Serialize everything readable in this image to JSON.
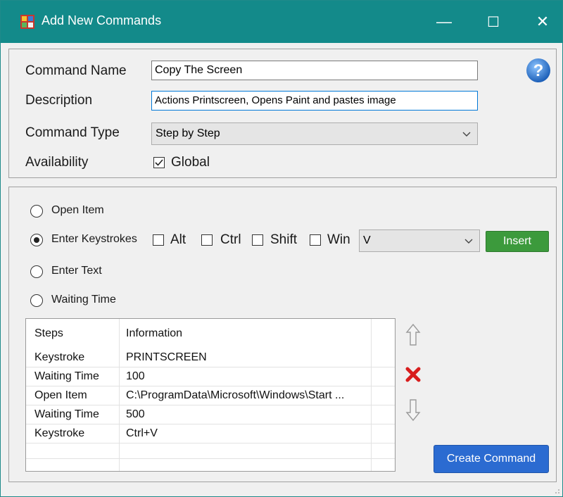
{
  "window": {
    "title": "Add New Commands",
    "minimize_glyph": "—",
    "maximize_glyph": "☐",
    "close_glyph": "✕"
  },
  "form": {
    "command_name_label": "Command Name",
    "command_name_value": "Copy The Screen",
    "description_label": "Description",
    "description_value": "Actions Printscreen, Opens Paint and pastes image",
    "command_type_label": "Command Type",
    "command_type_value": "Step by Step",
    "availability_label": "Availability",
    "global_label": "Global",
    "global_checked": true,
    "help_glyph": "?"
  },
  "actions": {
    "open_item_label": "Open Item",
    "enter_keystrokes_label": "Enter Keystrokes",
    "enter_text_label": "Enter Text",
    "waiting_time_label": "Waiting Time",
    "selected": "enter_keystrokes",
    "alt_label": "Alt",
    "ctrl_label": "Ctrl",
    "shift_label": "Shift",
    "win_label": "Win",
    "key_value": "V",
    "insert_label": "Insert"
  },
  "steps": {
    "headers": [
      "Steps",
      "Information"
    ],
    "rows": [
      [
        "Keystroke",
        "PRINTSCREEN"
      ],
      [
        "Waiting Time",
        "100"
      ],
      [
        "Open Item",
        "C:\\ProgramData\\Microsoft\\Windows\\Start ..."
      ],
      [
        "Waiting Time",
        "500"
      ],
      [
        "Keystroke",
        "Ctrl+V"
      ]
    ]
  },
  "buttons": {
    "create_command": "Create Command"
  },
  "colors": {
    "titlebar": "#138a8a",
    "insert": "#3c9a3c",
    "create": "#2b6bd1",
    "delete": "#d81e1e",
    "help": "#2f7fd6"
  }
}
